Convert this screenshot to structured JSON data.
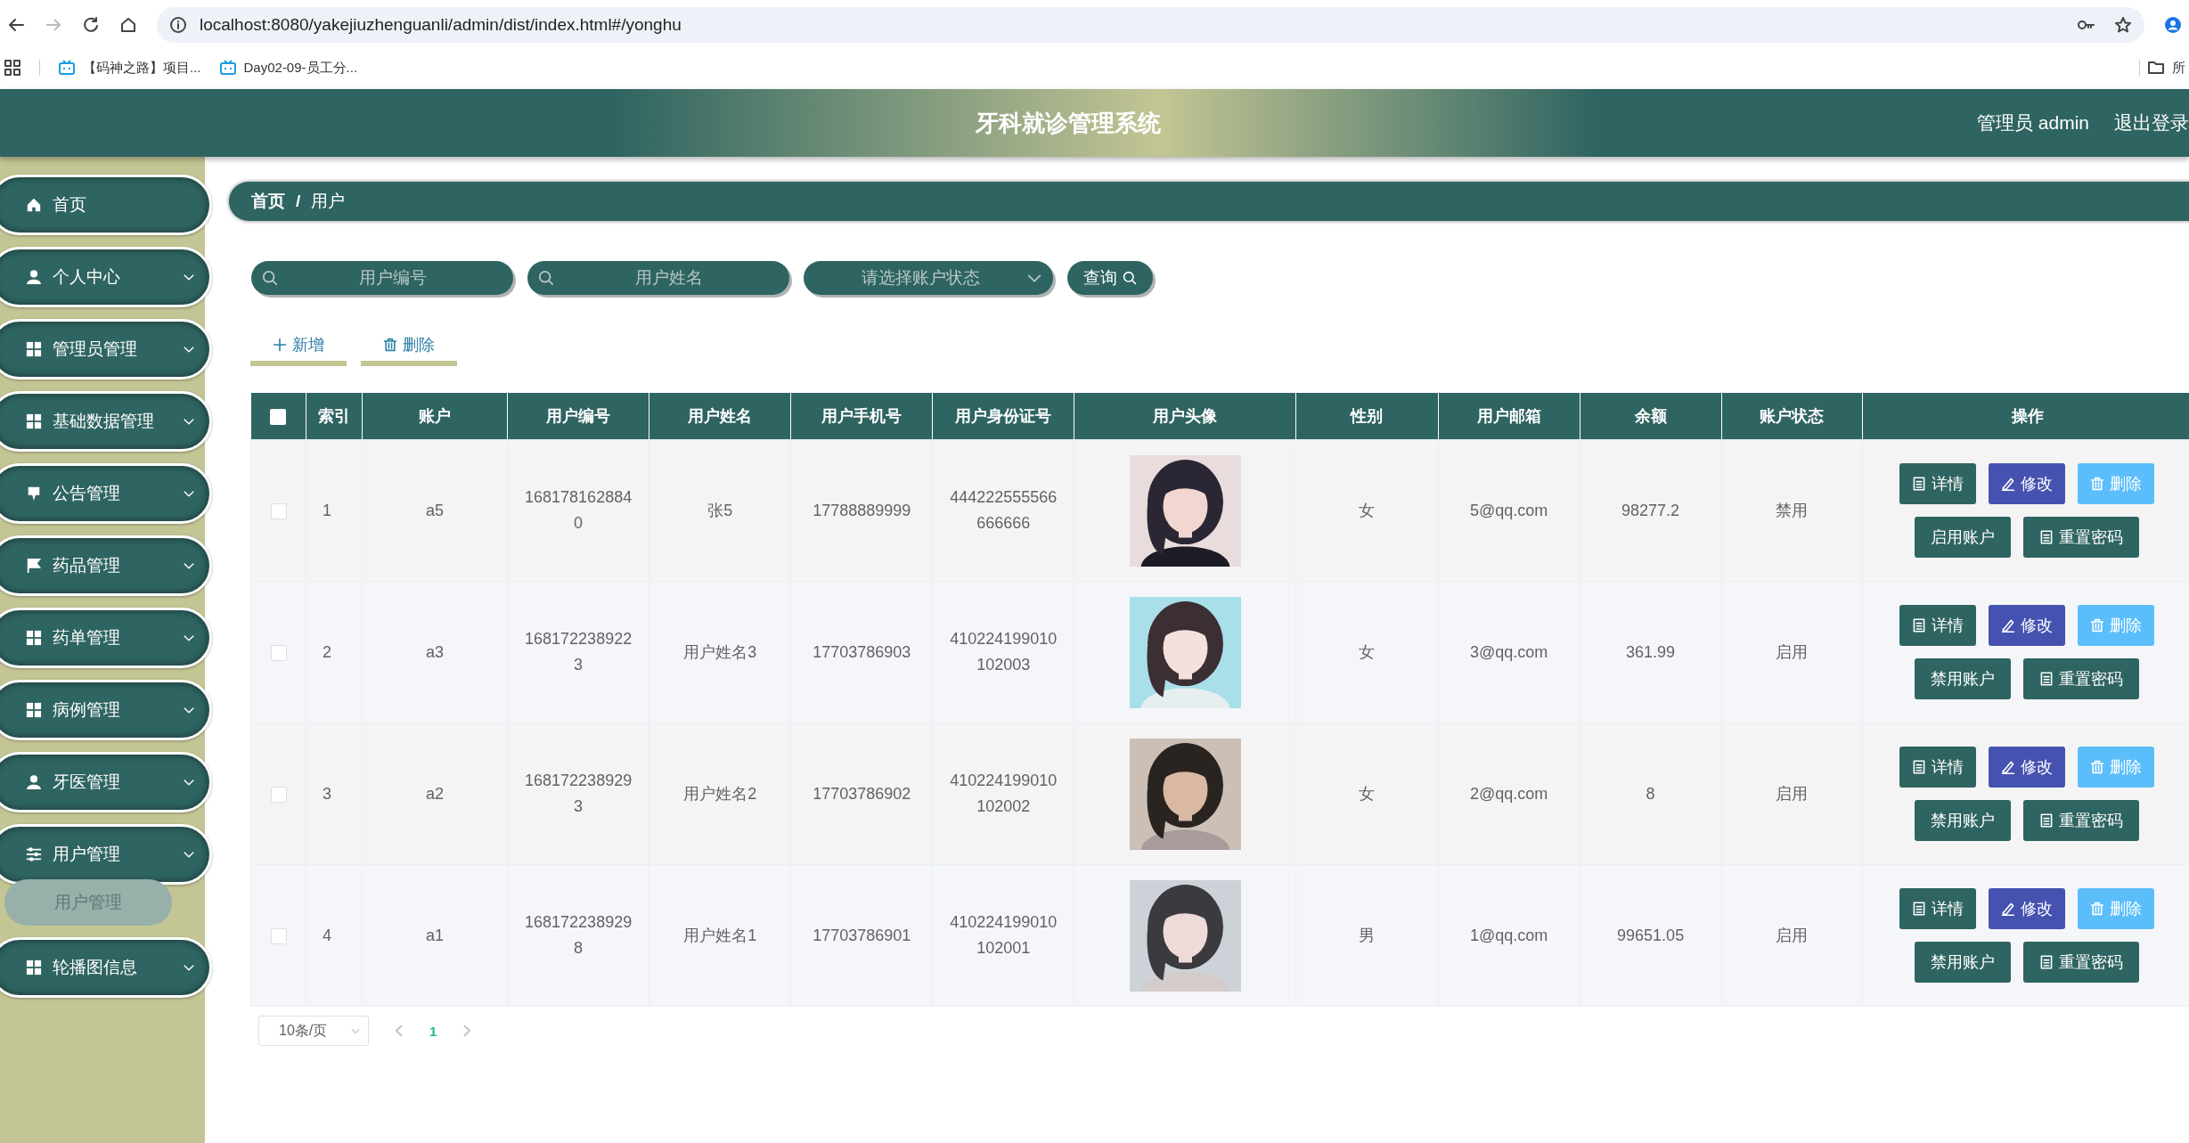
{
  "browser": {
    "url": "localhost:8080/yakejiuzhenguanli/admin/dist/index.html#/yonghu",
    "bookmarks": [
      {
        "label": "【码神之路】项目..."
      },
      {
        "label": "Day02-09-员工分..."
      }
    ],
    "all_bookmarks": "所"
  },
  "header": {
    "title": "牙科就诊管理系统",
    "user": "管理员 admin",
    "logout": "退出登录"
  },
  "sidebar": {
    "items": [
      {
        "kind": "link",
        "label": "首页"
      },
      {
        "kind": "group",
        "label": "个人中心"
      },
      {
        "kind": "group",
        "label": "管理员管理"
      },
      {
        "kind": "group",
        "label": "基础数据管理"
      },
      {
        "kind": "group",
        "label": "公告管理"
      },
      {
        "kind": "group",
        "label": "药品管理"
      },
      {
        "kind": "group",
        "label": "药单管理"
      },
      {
        "kind": "group",
        "label": "病例管理"
      },
      {
        "kind": "group",
        "label": "牙医管理"
      },
      {
        "kind": "group",
        "label": "用户管理",
        "expanded": true,
        "children": [
          {
            "label": "用户管理",
            "selected": true
          }
        ]
      },
      {
        "kind": "group",
        "label": "轮播图信息"
      }
    ]
  },
  "breadcrumb": {
    "items": [
      {
        "label": "首页"
      },
      {
        "label": "用户"
      }
    ],
    "separator": "/"
  },
  "search": {
    "fields": [
      {
        "kind": "text",
        "placeholder": "用户编号"
      },
      {
        "kind": "text",
        "placeholder": "用户姓名"
      },
      {
        "kind": "select",
        "placeholder": "请选择账户状态"
      }
    ],
    "button": "查询"
  },
  "toolbar": [
    {
      "kind": "add",
      "label": "新增"
    },
    {
      "kind": "delete",
      "label": "删除"
    }
  ],
  "table": {
    "all_checked": false,
    "columns": [
      "索引",
      "账户",
      "用户编号",
      "用户姓名",
      "用户手机号",
      "用户身份证号",
      "用户头像",
      "性别",
      "用户邮箱",
      "余额",
      "账户状态",
      "操作"
    ],
    "rows": [
      {
        "checked": false,
        "index": "1",
        "account": "a5",
        "code": "1681781628840",
        "name": "张5",
        "phone": "17788889999",
        "id_card": "444222555566666666",
        "gender": "女",
        "email": "5@qq.com",
        "balance": "98277.2",
        "status": "禁用",
        "actions": [
          {
            "kind": "detail",
            "label": "详情"
          },
          {
            "kind": "edit",
            "label": "修改"
          },
          {
            "kind": "delete",
            "label": "删除"
          },
          {
            "kind": "toggle",
            "label": "启用账户"
          },
          {
            "kind": "reset",
            "label": "重置密码"
          }
        ]
      },
      {
        "checked": false,
        "index": "2",
        "account": "a3",
        "code": "1681722389223",
        "name": "用户姓名3",
        "phone": "17703786903",
        "id_card": "410224199010102003",
        "gender": "女",
        "email": "3@qq.com",
        "balance": "361.99",
        "status": "启用",
        "actions": [
          {
            "kind": "detail",
            "label": "详情"
          },
          {
            "kind": "edit",
            "label": "修改"
          },
          {
            "kind": "delete",
            "label": "删除"
          },
          {
            "kind": "toggle",
            "label": "禁用账户"
          },
          {
            "kind": "reset",
            "label": "重置密码"
          }
        ]
      },
      {
        "checked": false,
        "index": "3",
        "account": "a2",
        "code": "1681722389293",
        "name": "用户姓名2",
        "phone": "17703786902",
        "id_card": "410224199010102002",
        "gender": "女",
        "email": "2@qq.com",
        "balance": "8",
        "status": "启用",
        "actions": [
          {
            "kind": "detail",
            "label": "详情"
          },
          {
            "kind": "edit",
            "label": "修改"
          },
          {
            "kind": "delete",
            "label": "删除"
          },
          {
            "kind": "toggle",
            "label": "禁用账户"
          },
          {
            "kind": "reset",
            "label": "重置密码"
          }
        ]
      },
      {
        "checked": false,
        "index": "4",
        "account": "a1",
        "code": "1681722389298",
        "name": "用户姓名1",
        "phone": "17703786901",
        "id_card": "410224199010102001",
        "gender": "男",
        "email": "1@qq.com",
        "balance": "99651.05",
        "status": "启用",
        "actions": [
          {
            "kind": "detail",
            "label": "详情"
          },
          {
            "kind": "edit",
            "label": "修改"
          },
          {
            "kind": "delete",
            "label": "删除"
          },
          {
            "kind": "toggle",
            "label": "禁用账户"
          },
          {
            "kind": "reset",
            "label": "重置密码"
          }
        ]
      }
    ]
  },
  "pagination": {
    "page_size": "10条/页",
    "pages": [
      {
        "label": "1",
        "selected": true
      }
    ]
  }
}
